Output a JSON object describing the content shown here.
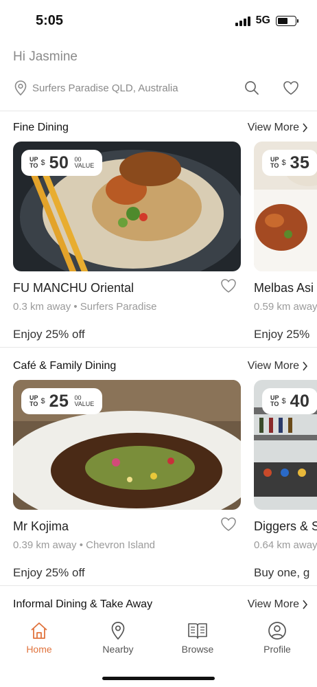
{
  "status_bar": {
    "time": "5:05",
    "network": "5G"
  },
  "header": {
    "greeting": "Hi Jasmine",
    "location": "Surfers Paradise QLD, Australia",
    "icons": [
      "location-pin-icon",
      "search-icon",
      "heart-icon"
    ]
  },
  "sections": [
    {
      "title": "Fine Dining",
      "view_more": "View More",
      "cards": [
        {
          "badge_upto_1": "UP",
          "badge_upto_2": "TO",
          "badge_currency": "$",
          "badge_amount": "50",
          "badge_cents": "00",
          "badge_value": "VALUE",
          "name": "FU MANCHU Oriental",
          "meta": "0.3 km away • Surfers Paradise",
          "offer": "Enjoy 25% off"
        },
        {
          "badge_upto_1": "UP",
          "badge_upto_2": "TO",
          "badge_currency": "$",
          "badge_amount": "35",
          "name": "Melbas Asi",
          "meta": "0.59 km away",
          "offer": "Enjoy 25%"
        }
      ]
    },
    {
      "title": "Café & Family Dining",
      "view_more": "View More",
      "cards": [
        {
          "badge_upto_1": "UP",
          "badge_upto_2": "TO",
          "badge_currency": "$",
          "badge_amount": "25",
          "badge_cents": "00",
          "badge_value": "VALUE",
          "name": "Mr Kojima",
          "meta": "0.39 km away • Chevron Island",
          "offer": "Enjoy 25% off"
        },
        {
          "badge_upto_1": "UP",
          "badge_upto_2": "TO",
          "badge_currency": "$",
          "badge_amount": "40",
          "name": "Diggers & S",
          "meta": "0.64 km away",
          "offer": "Buy one, g"
        }
      ]
    },
    {
      "title": "Informal Dining & Take Away",
      "view_more": "View More"
    }
  ],
  "tabbar": [
    {
      "label": "Home",
      "icon": "home-icon",
      "active": true
    },
    {
      "label": "Nearby",
      "icon": "location-pin-icon",
      "active": false
    },
    {
      "label": "Browse",
      "icon": "book-icon",
      "active": false
    },
    {
      "label": "Profile",
      "icon": "profile-icon",
      "active": false
    }
  ],
  "colors": {
    "accent": "#e0733d",
    "muted_text": "#8a8a8a"
  }
}
